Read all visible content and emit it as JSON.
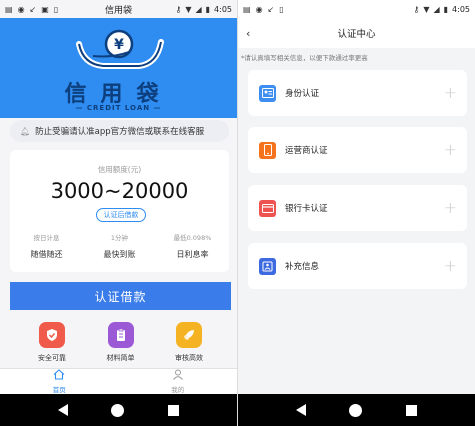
{
  "left": {
    "status_bar": {
      "time": "4:05",
      "title": "信用袋"
    },
    "banner": {
      "logo_text": "信用袋",
      "logo_subtext": "— CREDIT LOAN —",
      "currency_symbol": "¥"
    },
    "notice": {
      "text": "防止受骗请认准app官方微信或联系在线客服",
      "icon": "bell-icon"
    },
    "quota_card": {
      "label": "信用额度(元)",
      "value": "3000~20000",
      "button": "认证后借款",
      "features": [
        {
          "top": "按日计息",
          "bottom": "随借随还"
        },
        {
          "top": "1分钟",
          "bottom": "最快到账"
        },
        {
          "top": "最低0.098%",
          "bottom": "日利息率"
        }
      ]
    },
    "apply_button": "认证借款",
    "icons": [
      {
        "label": "安全可靠",
        "icon": "shield-icon",
        "color": "#f05a4a"
      },
      {
        "label": "材料简单",
        "icon": "clipboard-icon",
        "color": "#9b59d6"
      },
      {
        "label": "审核高效",
        "icon": "rocket-icon",
        "color": "#f5b324"
      }
    ],
    "tabs": [
      {
        "label": "首页",
        "icon": "home-icon",
        "active": true
      },
      {
        "label": "我的",
        "icon": "user-icon",
        "active": false
      }
    ]
  },
  "right": {
    "status_bar": {
      "time": "4:05"
    },
    "title": "认证中心",
    "hint": "*请认真填写相关信息，以便下款通过率更高",
    "items": [
      {
        "label": "身份认证",
        "icon": "id-card-icon",
        "color": "#3d8ef0"
      },
      {
        "label": "运营商认证",
        "icon": "phone-icon",
        "color": "#f5731c"
      },
      {
        "label": "银行卡认证",
        "icon": "bank-card-icon",
        "color": "#ef5350"
      },
      {
        "label": "补充信息",
        "icon": "info-icon",
        "color": "#3d6ae0"
      }
    ]
  },
  "colors": {
    "primary": "#2f8cf0",
    "button": "#3a7ce9"
  }
}
